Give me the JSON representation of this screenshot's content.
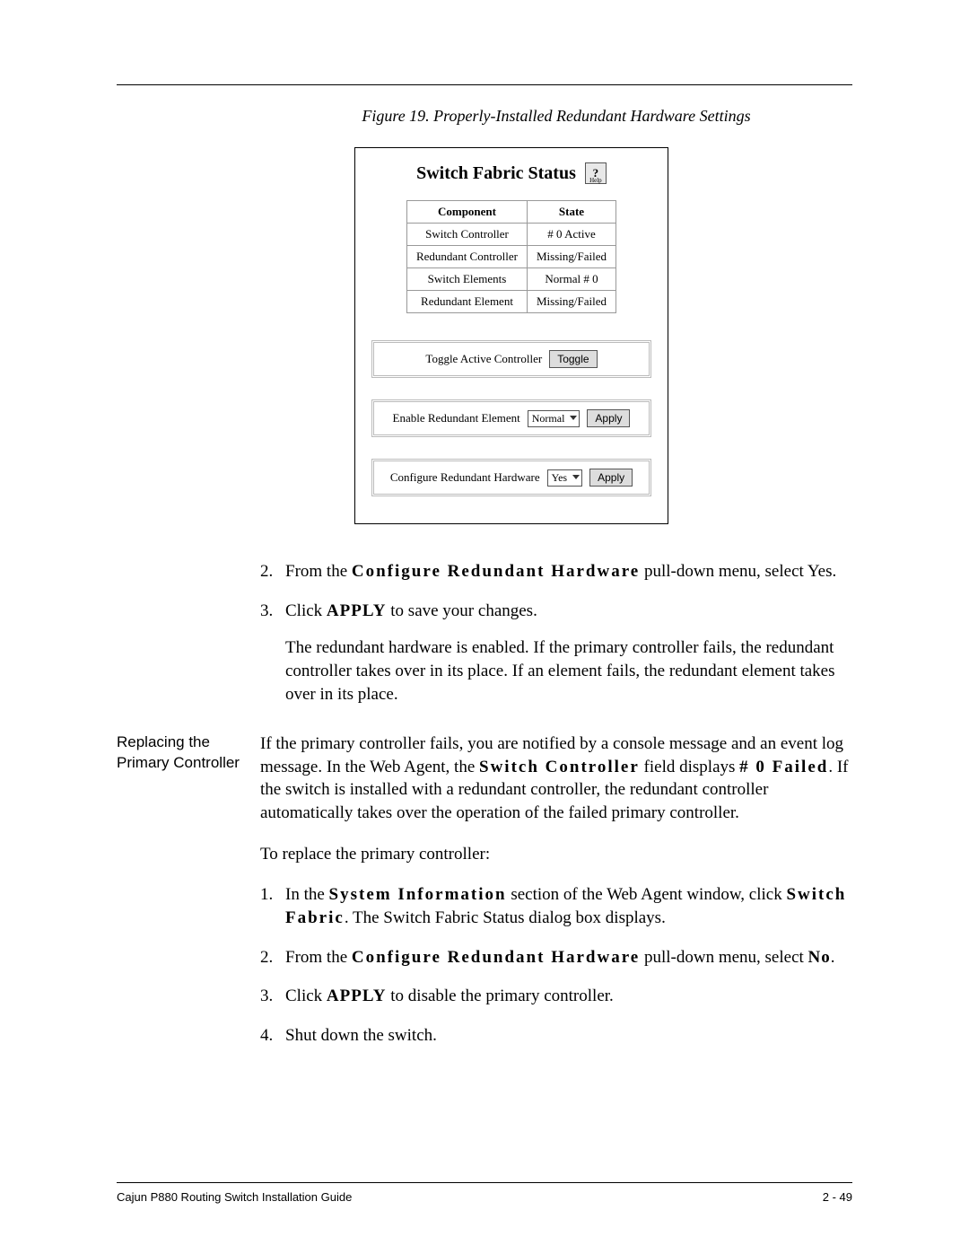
{
  "figure": {
    "caption": "Figure 19. Properly-Installed Redundant Hardware Settings",
    "panel_title": "Switch Fabric Status",
    "help_label": "Help",
    "table": {
      "headers": [
        "Component",
        "State"
      ],
      "rows": [
        [
          "Switch Controller",
          "# 0 Active"
        ],
        [
          "Redundant Controller",
          "Missing/Failed"
        ],
        [
          "Switch Elements",
          "Normal # 0"
        ],
        [
          "Redundant Element",
          "Missing/Failed"
        ]
      ]
    },
    "controls": {
      "toggle_label": "Toggle Active Controller",
      "toggle_button": "Toggle",
      "enable_label": "Enable Redundant Element",
      "enable_select": "Normal",
      "enable_button": "Apply",
      "configure_label": "Configure Redundant Hardware",
      "configure_select": "Yes",
      "configure_button": "Apply"
    }
  },
  "steps_a": {
    "s2_num": "2.",
    "s2_pre": "From the ",
    "s2_bold": "Configure Redundant Hardware",
    "s2_post": " pull-down menu, select Yes.",
    "s3_num": "3.",
    "s3_pre": "Click ",
    "s3_bold": "APPLY",
    "s3_post": " to save your changes.",
    "s3_sub": "The redundant hardware is enabled. If the primary controller fails, the redundant controller takes over in its place. If an element fails, the redundant element takes over in its place."
  },
  "section": {
    "heading": "Replacing the Primary Controller",
    "para1_pre": "If the primary controller fails, you are notified by a console message and an event log message. In the Web Agent, the ",
    "para1_b1": "Switch Controller",
    "para1_mid": " field displays ",
    "para1_b2": "# 0 Failed",
    "para1_post": ". If the switch is installed with a redundant controller, the redundant controller automatically takes over the operation of the failed primary controller.",
    "para2": "To replace the primary controller:"
  },
  "steps_b": {
    "s1_num": "1.",
    "s1_pre": "In the ",
    "s1_b1": "System Information",
    "s1_mid": " section of the Web Agent window, click ",
    "s1_b2": "Switch Fabric",
    "s1_post": ". The Switch Fabric Status dialog box displays.",
    "s2_num": "2.",
    "s2_pre": "From the ",
    "s2_bold": "Configure Redundant Hardware",
    "s2_post": " pull-down menu, select ",
    "s2_b2": "No",
    "s2_end": ".",
    "s3_num": "3.",
    "s3_pre": "Click ",
    "s3_bold": "APPLY",
    "s3_post": " to disable the primary controller.",
    "s4_num": "4.",
    "s4_text": "Shut down the switch."
  },
  "footer": {
    "left": "Cajun P880 Routing Switch Installation Guide",
    "right": "2 - 49"
  }
}
